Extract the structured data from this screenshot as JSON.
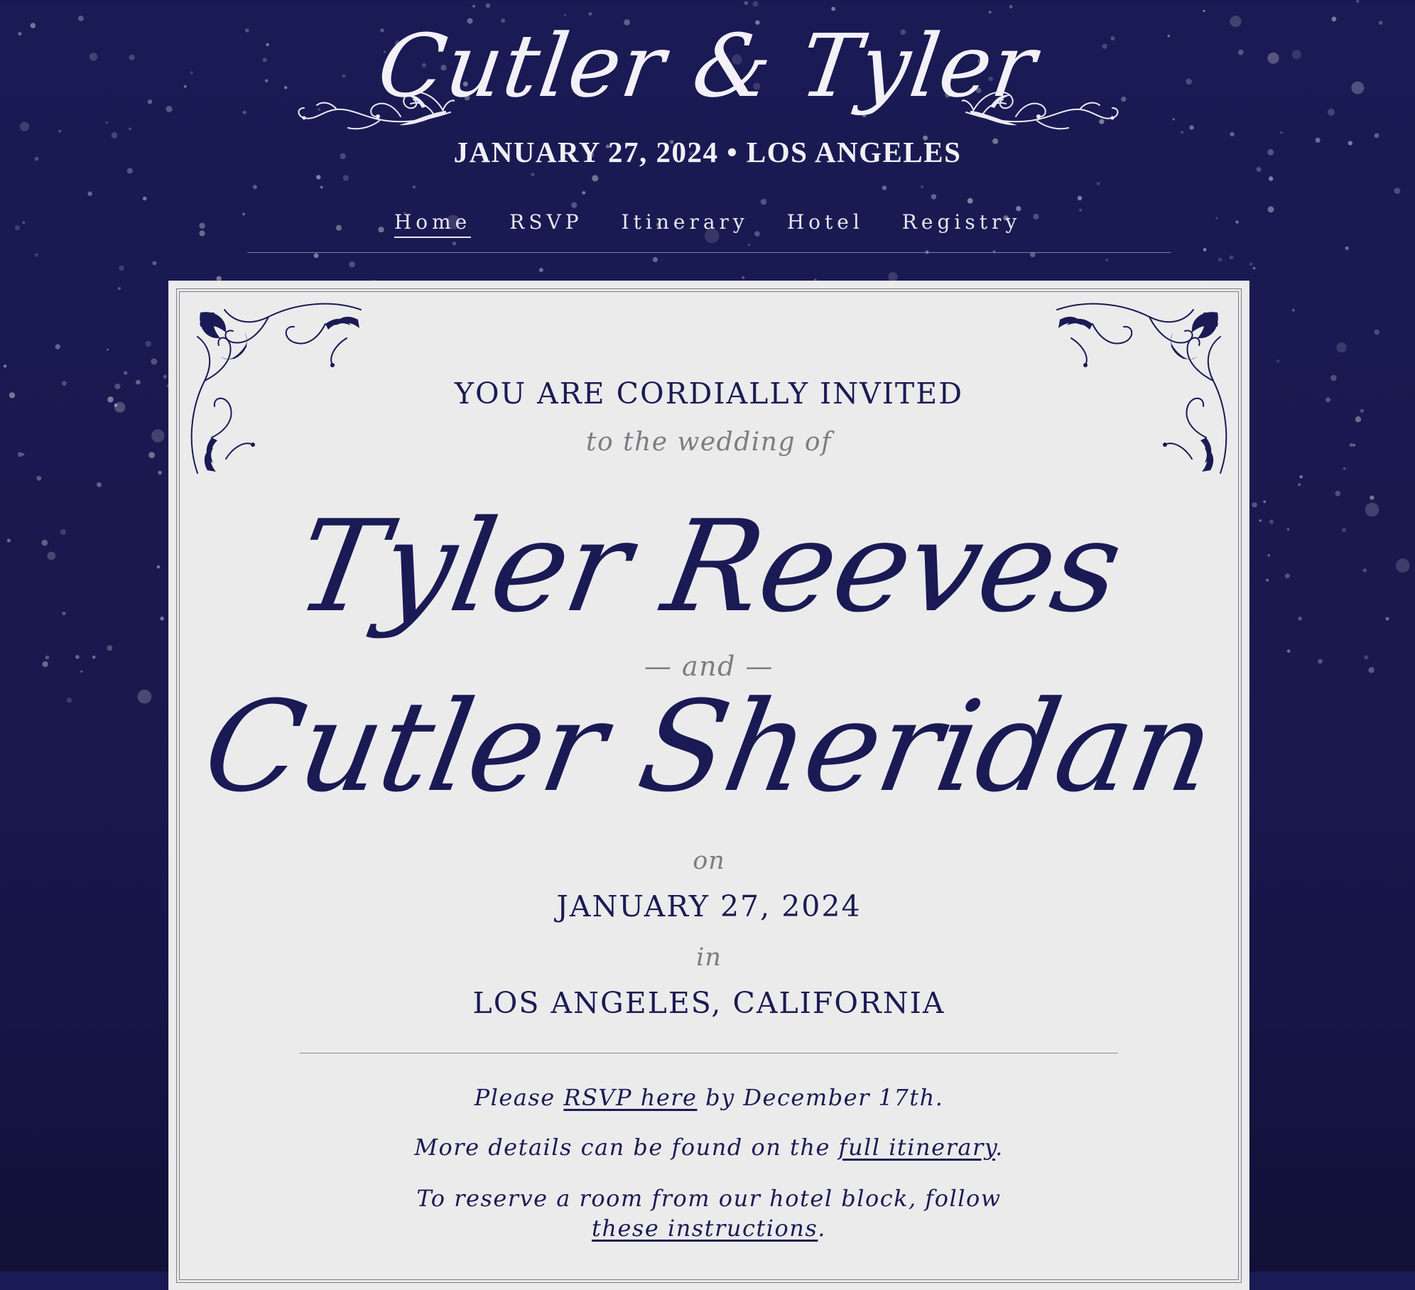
{
  "header": {
    "title": "Cutler & Tyler",
    "subtitle": "JANUARY 27, 2024 • LOS ANGELES"
  },
  "nav": {
    "items": [
      {
        "label": "Home",
        "active": true
      },
      {
        "label": "RSVP",
        "active": false
      },
      {
        "label": "Itinerary",
        "active": false
      },
      {
        "label": "Hotel",
        "active": false
      },
      {
        "label": "Registry",
        "active": false
      }
    ]
  },
  "invitation": {
    "headline": "YOU ARE CORDIALLY INVITED",
    "lead": "to the wedding of",
    "name_one": "Tyler Reeves",
    "connector": "— and —",
    "name_two": "Cutler Sheridan",
    "on_word": "on",
    "date": "JANUARY 27, 2024",
    "in_word": "in",
    "location": "LOS ANGELES, CALIFORNIA"
  },
  "details": {
    "rsvp_prefix": "Please ",
    "rsvp_link": "RSVP here",
    "rsvp_suffix": " by December 17th.",
    "itinerary_prefix": "More details can be found on the ",
    "itinerary_link": "full itinerary",
    "itinerary_suffix": ".",
    "hotel_prefix": "To reserve a room from our hotel block, follow ",
    "hotel_link": "these instructions",
    "hotel_suffix": "."
  },
  "colors": {
    "background": "#1a1a54",
    "ink": "#1b1b54",
    "card": "#ebebec",
    "muted": "#7c7c82"
  },
  "icons": {
    "header_ornament": "flourish-ornament-icon",
    "card_corner": "corner-filigree-icon"
  }
}
